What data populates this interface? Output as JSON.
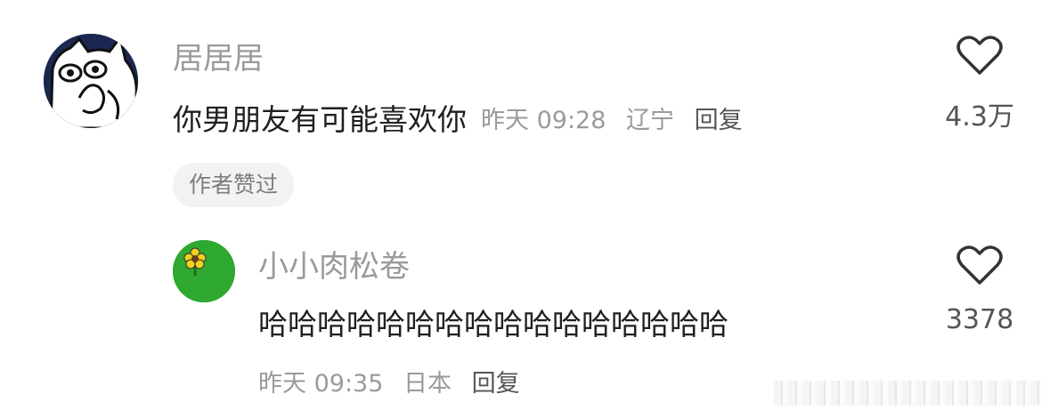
{
  "comment": {
    "username": "居居居",
    "text": "你男朋友有可能喜欢你",
    "time": "昨天 09:28",
    "location": "辽宁",
    "reply_label": "回复",
    "like_count": "4.3万",
    "badge": "作者赞过"
  },
  "reply": {
    "username": "小小肉松卷",
    "text": "哈哈哈哈哈哈哈哈哈哈哈哈哈哈哈哈",
    "time": "昨天 09:35",
    "location": "日本",
    "reply_label": "回复",
    "like_count": "3378"
  },
  "icons": {
    "like": "heart-outline-icon",
    "avatar_1": "cartoon-cat-avatar",
    "avatar_2": "yellow-flower-avatar"
  },
  "colors": {
    "username": "#9a9a9a",
    "text": "#1f1f1f",
    "badge_bg": "#f2f2f2",
    "avatar2_bg": "#2fa82f"
  }
}
